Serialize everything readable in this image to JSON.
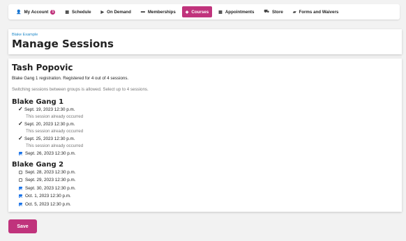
{
  "nav": {
    "items": [
      {
        "label": "My Account",
        "icon": "user-icon",
        "glyph": "👤",
        "badge": "1",
        "active": false
      },
      {
        "label": "Schedule",
        "icon": "calendar-icon",
        "glyph": "▦",
        "active": false
      },
      {
        "label": "On Demand",
        "icon": "video-icon",
        "glyph": "▶",
        "active": false
      },
      {
        "label": "Memberships",
        "icon": "card-icon",
        "glyph": "▬",
        "active": false
      },
      {
        "label": "Courses",
        "icon": "courses-icon",
        "glyph": "◈",
        "active": true
      },
      {
        "label": "Appointments",
        "icon": "calendar-icon",
        "glyph": "▦",
        "active": false
      },
      {
        "label": "Store",
        "icon": "cart-icon",
        "glyph": "⛟",
        "active": false
      },
      {
        "label": "Forms and Waivers",
        "icon": "folder-icon",
        "glyph": "▰",
        "active": false
      }
    ],
    "accent": "#c0337c"
  },
  "header": {
    "breadcrumb": "Blake Example",
    "title": "Manage Sessions"
  },
  "main": {
    "person": "Tash Popovic",
    "registration": "Blake Gang 1 registration. Registered for 4 out of 4 sessions.",
    "info": "Switching sessions between groups is allowed. Select up to 4 sessions.",
    "occurred_text": "This session already occurred",
    "groups": [
      {
        "title": "Blake Gang 1",
        "sessions": [
          {
            "label": "Sept. 19, 2023 12:30 p.m.",
            "state": "occurred"
          },
          {
            "label": "Sept. 20, 2023 12:30 p.m.",
            "state": "occurred"
          },
          {
            "label": "Sept. 25, 2023 12:30 p.m.",
            "state": "occurred"
          },
          {
            "label": "Sept. 26, 2023 12:30 p.m.",
            "state": "checked"
          }
        ]
      },
      {
        "title": "Blake Gang 2",
        "sessions": [
          {
            "label": "Sept. 28, 2023 12:30 p.m.",
            "state": "unchecked"
          },
          {
            "label": "Sept. 29, 2023 12:30 p.m.",
            "state": "unchecked"
          },
          {
            "label": "Sept. 30, 2023 12:30 p.m.",
            "state": "checked"
          },
          {
            "label": "Oct. 1, 2023 12:30 p.m.",
            "state": "checked"
          },
          {
            "label": "Oct. 5, 2023 12:30 p.m.",
            "state": "checked"
          }
        ]
      }
    ]
  },
  "actions": {
    "save_label": "Save"
  }
}
